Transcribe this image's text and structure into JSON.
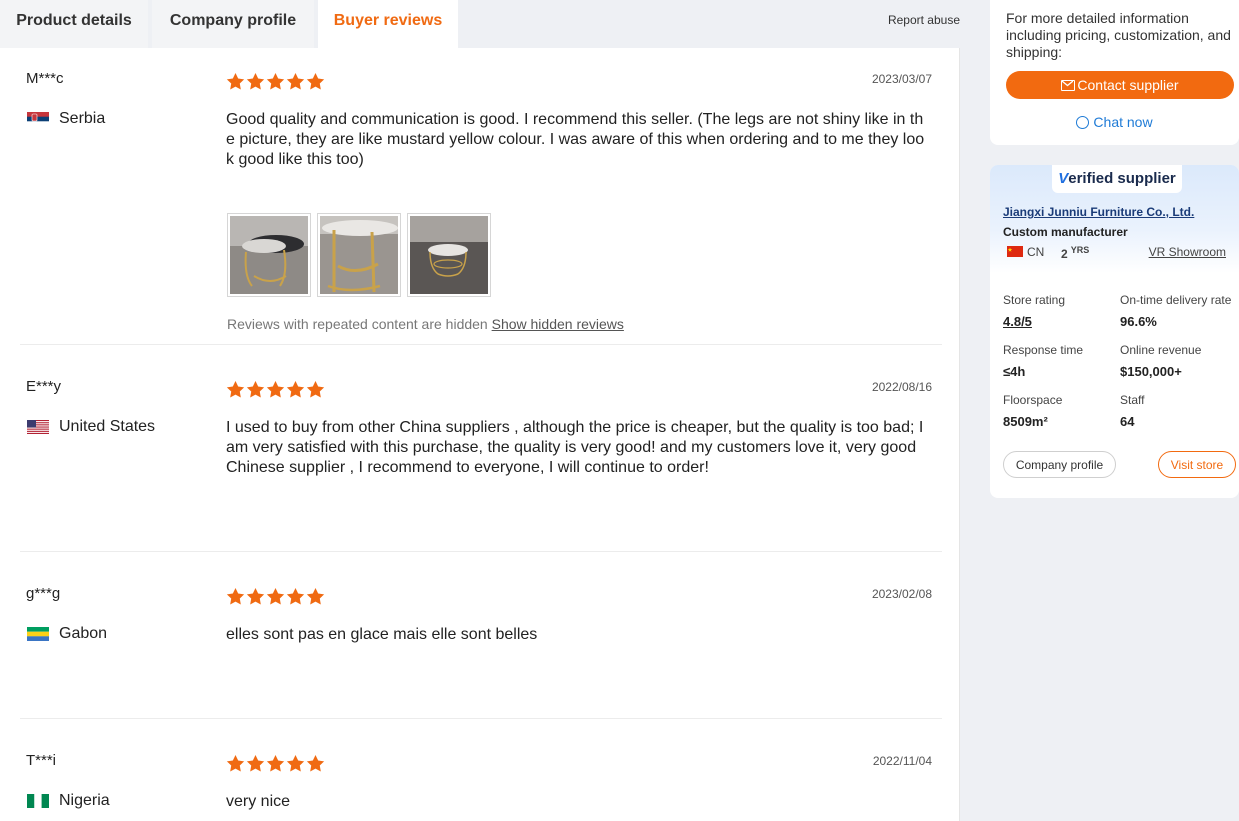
{
  "tabs": [
    {
      "label": "Product details"
    },
    {
      "label": "Company profile"
    },
    {
      "label": "Buyer reviews"
    }
  ],
  "report_abuse": "Report abuse",
  "reviews": [
    {
      "name": "M***c",
      "country": "Serbia",
      "date": "2023/03/07",
      "rating": 5,
      "text": "Good quality and communication is good. I recommend this seller. (The legs are not shiny like in the picture, they are like mustard yellow colour. I was aware of this when ordering and to me they look good like this too)"
    },
    {
      "name": "E***y",
      "country": "United States",
      "date": "2022/08/16",
      "rating": 5,
      "text": "I used to buy from other China suppliers , although the price is cheaper, but the quality is too bad; I am very satisfied with this purchase, the quality is very good!   and my customers love it, very good Chinese supplier , I recommend to everyone, I will continue to order!"
    },
    {
      "name": "g***g",
      "country": "Gabon",
      "date": "2023/02/08",
      "rating": 5,
      "text": "elles sont pas en glace mais elle sont belles"
    },
    {
      "name": "T***i",
      "country": "Nigeria",
      "date": "2022/11/04",
      "rating": 5,
      "text": "very nice"
    }
  ],
  "hidden_note": {
    "text": "Reviews with repeated content are hidden",
    "link": "Show hidden reviews"
  },
  "sidebar": {
    "info": "For more detailed information including pricing, customization, and shipping:",
    "contact_label": "Contact supplier",
    "chat_label": "Chat now"
  },
  "supplier": {
    "badge_v": "V",
    "badge_rest": "erified supplier",
    "company": "Jiangxi Junniu Furniture Co., Ltd.",
    "type": "Custom manufacturer",
    "country": "CN",
    "years": "2",
    "years_unit": "YRS",
    "vr_label": "VR Showroom",
    "stats": {
      "store_rating_label": "Store rating",
      "store_rating": "4.8/5",
      "ontime_label": "On-time delivery rate",
      "ontime": "96.6%",
      "response_label": "Response time",
      "response": "≤4h",
      "revenue_label": "Online revenue",
      "revenue": "$150,000+",
      "floor_label": "Floorspace",
      "floor": "8509m²",
      "staff_label": "Staff",
      "staff": "64"
    },
    "company_profile_btn": "Company profile",
    "visit_store_btn": "Visit store"
  },
  "colors": {
    "accent": "#f06a12",
    "link_blue": "#1f7bd6",
    "company_blue": "#1a3b78"
  }
}
